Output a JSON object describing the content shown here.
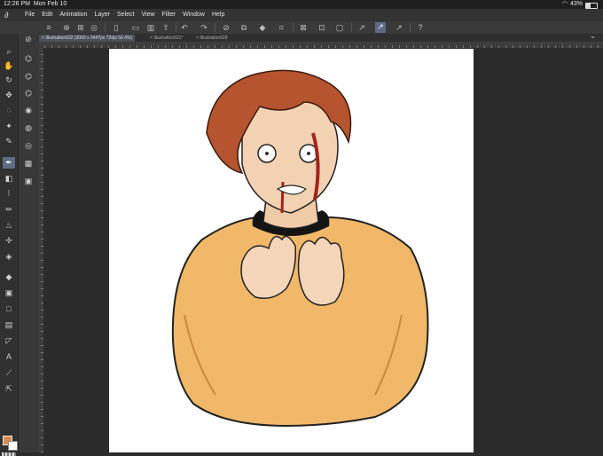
{
  "status": {
    "time": "12:26 PM",
    "date": "Mon Feb 10",
    "battery": "43%"
  },
  "menu": [
    "File",
    "Edit",
    "Animation",
    "Layer",
    "Select",
    "View",
    "Filter",
    "Window",
    "Help"
  ],
  "tabs": [
    {
      "label": "Illustration632 (3000 x 3447px 72dpi 56.4%)",
      "active": true
    },
    {
      "label": "Illustration631*",
      "active": false
    },
    {
      "label": "Illustration628",
      "active": false
    }
  ],
  "colors": {
    "main": "#d98a48",
    "sub": "#ffffff",
    "accent": "#5d6b86"
  }
}
